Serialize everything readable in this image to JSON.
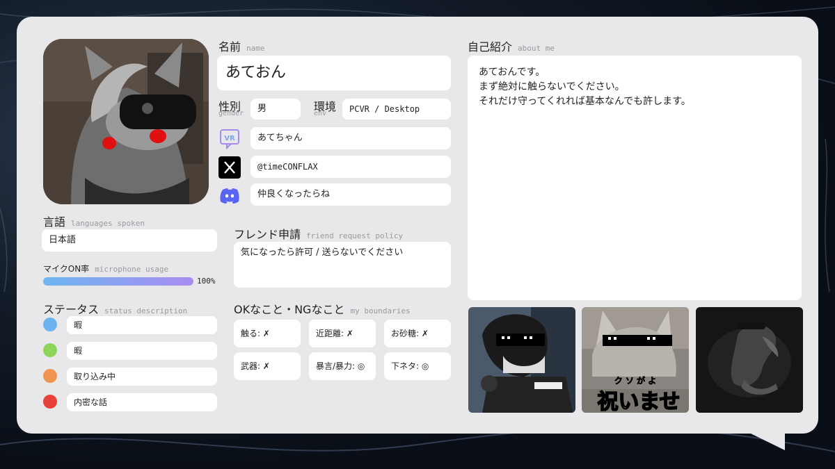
{
  "profile": {
    "name_label": "名前",
    "name_sub": "name",
    "name_value": "あておん",
    "gender_label": "性別",
    "gender_sub": "gender",
    "gender_value": "男",
    "env_label": "環境",
    "env_sub": "env",
    "env_value": "PCVR / Desktop",
    "vrchat_value": "あてちゃん",
    "x_value": "@timeCONFLAX",
    "discord_value": "仲良くなったらね"
  },
  "about": {
    "label": "自己紹介",
    "sub": "about me",
    "lines": [
      "あておんです。",
      "まず絶対に触らないでください。",
      "それだけ守ってくれれば基本なんでも許します。"
    ]
  },
  "languages": {
    "label": "言語",
    "sub": "languages spoken",
    "value": "日本語"
  },
  "mic": {
    "label": "マイクON率",
    "sub": "microphone usage",
    "percent_label": "100%",
    "fraction": 1.0
  },
  "status": {
    "label": "ステータス",
    "sub": "status description",
    "items": [
      {
        "color": "#6cb4f0",
        "text": "暇"
      },
      {
        "color": "#8fd45a",
        "text": "暇"
      },
      {
        "color": "#f0944f",
        "text": "取り込み中"
      },
      {
        "color": "#e8413a",
        "text": "内密な話"
      }
    ]
  },
  "friend": {
    "label": "フレンド申請",
    "sub": "friend request policy",
    "value": "気になったら許可 / 送らないでください"
  },
  "boundaries": {
    "label": "OKなこと・NGなこと",
    "sub": "my boundaries",
    "items": [
      "触る: ✗",
      "近距離: ✗",
      "お砂糖: ✗",
      "武器: ✗",
      "暴言/暴力: ◎",
      "下ネタ: ◎"
    ]
  },
  "photos": {
    "caption_ruby": "ク ソ が よ",
    "caption_text": "祝いませ"
  },
  "icons": [
    "vrchat-icon",
    "x-icon",
    "discord-icon"
  ],
  "colors": {
    "accent_start": "#6fb6f2",
    "accent_end": "#a98cf0"
  }
}
